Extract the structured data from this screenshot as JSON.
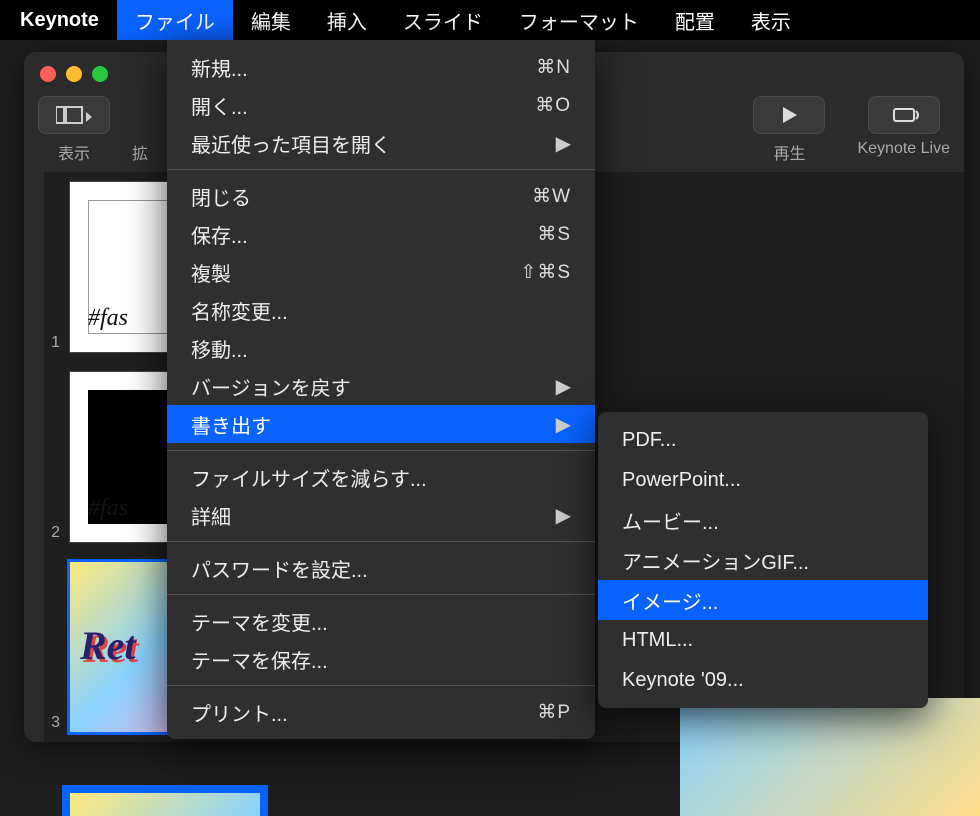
{
  "menubar": {
    "app": "Keynote",
    "items": [
      "ファイル",
      "編集",
      "挿入",
      "スライド",
      "フォーマット",
      "配置",
      "表示"
    ],
    "active_index": 0
  },
  "toolbar": {
    "view_label": "表示",
    "zoom_label": "拡",
    "play_label": "再生",
    "live_label": "Keynote Live"
  },
  "slides": {
    "nums": [
      "1",
      "2",
      "3"
    ]
  },
  "file_menu": {
    "groups": [
      [
        {
          "label": "新規...",
          "shortcut": "⌘N"
        },
        {
          "label": "開く...",
          "shortcut": "⌘O"
        },
        {
          "label": "最近使った項目を開く",
          "arrow": true
        }
      ],
      [
        {
          "label": "閉じる",
          "shortcut": "⌘W"
        },
        {
          "label": "保存...",
          "shortcut": "⌘S"
        },
        {
          "label": "複製",
          "shortcut": "⇧⌘S"
        },
        {
          "label": "名称変更..."
        },
        {
          "label": "移動..."
        },
        {
          "label": "バージョンを戻す",
          "arrow": true
        },
        {
          "label": "書き出す",
          "arrow": true,
          "highlighted": true
        }
      ],
      [
        {
          "label": "ファイルサイズを減らす..."
        },
        {
          "label": "詳細",
          "arrow": true
        }
      ],
      [
        {
          "label": "パスワードを設定..."
        }
      ],
      [
        {
          "label": "テーマを変更..."
        },
        {
          "label": "テーマを保存..."
        }
      ],
      [
        {
          "label": "プリント...",
          "shortcut": "⌘P"
        }
      ]
    ]
  },
  "export_submenu": {
    "items": [
      {
        "label": "PDF..."
      },
      {
        "label": "PowerPoint..."
      },
      {
        "label": "ムービー..."
      },
      {
        "label": "アニメーションGIF..."
      },
      {
        "label": "イメージ...",
        "highlighted": true
      },
      {
        "label": "HTML..."
      },
      {
        "label": "Keynote '09..."
      }
    ]
  },
  "thumb_text": {
    "fashion": "#fas",
    "retro": "Ret"
  }
}
